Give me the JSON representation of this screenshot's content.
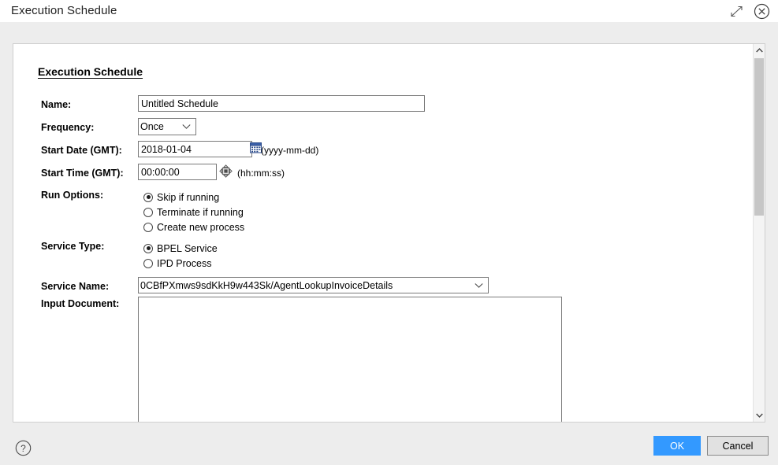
{
  "window": {
    "title": "Execution Schedule",
    "expand_icon": "expand-diagonal-icon",
    "close_icon": "close-circle-icon"
  },
  "panel": {
    "section_title": "Execution Schedule"
  },
  "form": {
    "name": {
      "label": "Name:",
      "value": "Untitled Schedule",
      "placeholder": ""
    },
    "frequency": {
      "label": "Frequency:",
      "value": "Once",
      "options": [
        "Once"
      ]
    },
    "start_date": {
      "label": "Start Date (GMT):",
      "value": "2018-01-04",
      "hint": "(yyyy-mm-dd)",
      "picker_icon": "calendar-icon"
    },
    "start_time": {
      "label": "Start Time (GMT):",
      "value": "00:00:00",
      "hint": "(hh:mm:ss)",
      "spinner_icon": "time-spinner-icon"
    },
    "run_options": {
      "label": "Run Options:",
      "selected": "Skip if running",
      "options": [
        {
          "label": "Skip if running",
          "selected": true
        },
        {
          "label": "Terminate if running",
          "selected": false
        },
        {
          "label": "Create new process",
          "selected": false
        }
      ]
    },
    "service_type": {
      "label": "Service Type:",
      "selected": "BPEL Service",
      "options": [
        {
          "label": "BPEL Service",
          "selected": true
        },
        {
          "label": "IPD Process",
          "selected": false
        }
      ]
    },
    "service_name": {
      "label": "Service Name:",
      "value": "0CBfPXmws9sdKkH9w443Sk/AgentLookupInvoiceDetails",
      "options": [
        "0CBfPXmws9sdKkH9w443Sk/AgentLookupInvoiceDetails"
      ]
    },
    "input_document": {
      "label": "Input Document:",
      "value": "",
      "placeholder": ""
    }
  },
  "scrollbar": {
    "up_icon": "chevron-up-icon",
    "down_icon": "chevron-down-icon"
  },
  "footer": {
    "help_icon": "help-circle-icon",
    "ok_label": "OK",
    "cancel_label": "Cancel"
  },
  "colors": {
    "accent": "#3399ff",
    "backdrop": "#ededed",
    "panel": "#ffffff",
    "border": "#7a7a7a"
  }
}
